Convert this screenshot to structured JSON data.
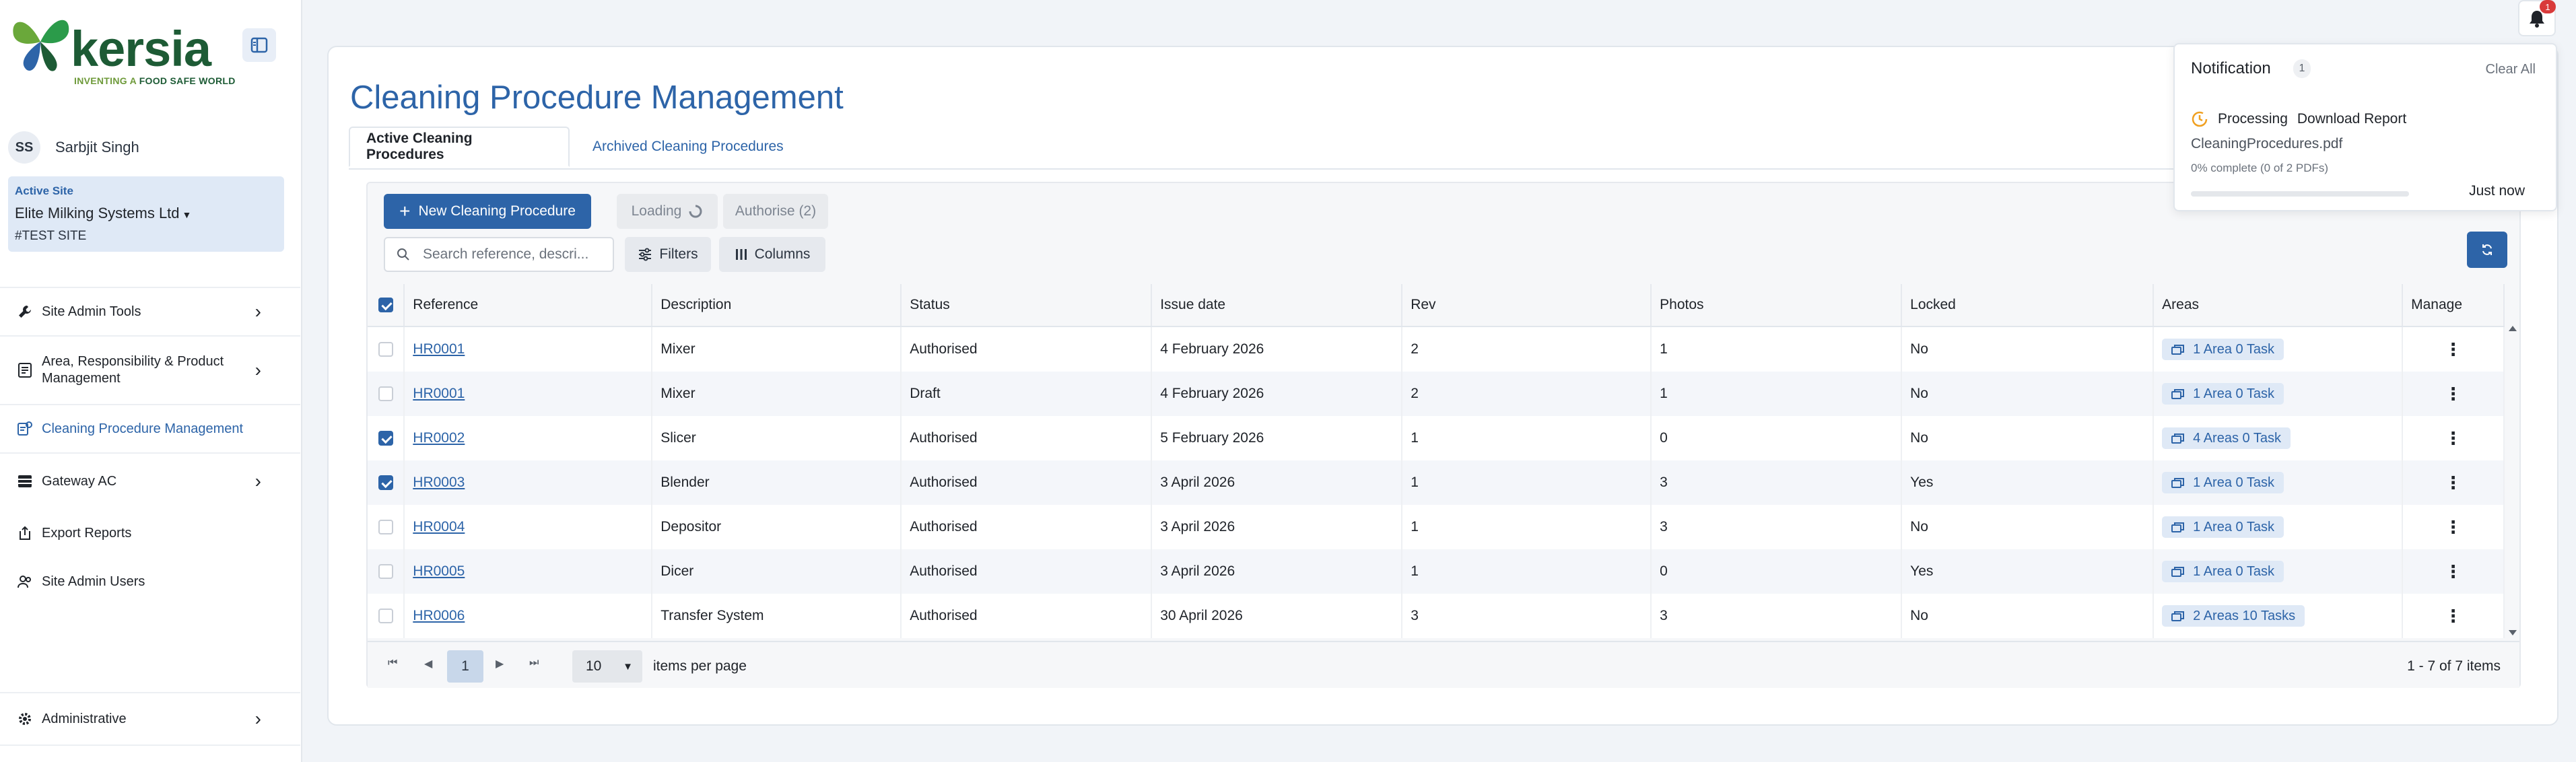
{
  "brand": {
    "logo_text": "kersia",
    "tagline_left": "INVENTING A",
    "tagline_right": "FOOD SAFE WORLD"
  },
  "user": {
    "initials": "SS",
    "name": "Sarbjit Singh"
  },
  "site": {
    "label": "Active Site",
    "name": "Elite Milking Systems Ltd",
    "code": "#TEST SITE"
  },
  "nav": [
    {
      "label": "Site Admin Tools",
      "icon": "wrench-icon"
    },
    {
      "label": "Area, Responsibility & Product Management",
      "icon": "clipboard-icon"
    },
    {
      "label": "Cleaning Procedure Management",
      "icon": "procedure-icon"
    },
    {
      "label": "Gateway AC",
      "icon": "gateway-icon"
    },
    {
      "label": "Export Reports",
      "icon": "export-icon"
    },
    {
      "label": "Site Admin Users",
      "icon": "users-icon"
    },
    {
      "label": "Administrative",
      "icon": "gear-icon"
    }
  ],
  "page": {
    "title": "Cleaning Procedure Management",
    "tabs": [
      "Active Cleaning Procedures",
      "Archived Cleaning Procedures"
    ]
  },
  "toolbar": {
    "new_label": "New Cleaning Procedure",
    "loading_label": "Loading",
    "authorise_label": "Authorise (2)",
    "search_placeholder": "Search reference, descri...",
    "filters_label": "Filters",
    "columns_label": "Columns"
  },
  "table": {
    "columns": [
      "Reference",
      "Description",
      "Status",
      "Issue date",
      "Rev",
      "Photos",
      "Locked",
      "Areas",
      "Manage"
    ],
    "rows": [
      {
        "checked": false,
        "reference": "HR0001",
        "description": "Mixer",
        "status": "Authorised",
        "issue_date": "4 February 2026",
        "rev": "2",
        "photos": "1",
        "locked": "No",
        "areas": "1 Area 0 Task"
      },
      {
        "checked": false,
        "reference": "HR0001",
        "description": "Mixer",
        "status": "Draft",
        "issue_date": "4 February 2026",
        "rev": "2",
        "photos": "1",
        "locked": "No",
        "areas": "1 Area 0 Task"
      },
      {
        "checked": true,
        "reference": "HR0002",
        "description": "Slicer",
        "status": "Authorised",
        "issue_date": "5 February 2026",
        "rev": "1",
        "photos": "0",
        "locked": "No",
        "areas": "4 Areas 0 Task"
      },
      {
        "checked": true,
        "reference": "HR0003",
        "description": "Blender",
        "status": "Authorised",
        "issue_date": "3 April 2026",
        "rev": "1",
        "photos": "3",
        "locked": "Yes",
        "areas": "1 Area 0 Task"
      },
      {
        "checked": false,
        "reference": "HR0004",
        "description": "Depositor",
        "status": "Authorised",
        "issue_date": "3 April 2026",
        "rev": "1",
        "photos": "3",
        "locked": "No",
        "areas": "1 Area 0 Task"
      },
      {
        "checked": false,
        "reference": "HR0005",
        "description": "Dicer",
        "status": "Authorised",
        "issue_date": "3 April 2026",
        "rev": "1",
        "photos": "0",
        "locked": "Yes",
        "areas": "1 Area 0 Task"
      },
      {
        "checked": false,
        "reference": "HR0006",
        "description": "Transfer System",
        "status": "Authorised",
        "issue_date": "30 April 2026",
        "rev": "3",
        "photos": "3",
        "locked": "No",
        "areas": "2 Areas 10 Tasks"
      }
    ]
  },
  "pager": {
    "page": "1",
    "page_size": "10",
    "items_per_page_label": "items per page",
    "count_text": "1 - 7 of 7 items"
  },
  "notifications": {
    "badge": "1",
    "title": "Notification",
    "count": "1",
    "clear_label": "Clear All",
    "item": {
      "status": "Processing",
      "action": "Download Report",
      "file": "CleaningProcedures.pdf",
      "progress_text": "0% complete (0 of 2 PDFs)",
      "progress": 0,
      "time": "Just now"
    }
  },
  "colors": {
    "primary": "#2d64a8",
    "brand_green": "#1d5b35",
    "badge_bg": "#dfe9f6",
    "alert_red": "#d93a3a",
    "processing_orange": "#f0a020"
  }
}
